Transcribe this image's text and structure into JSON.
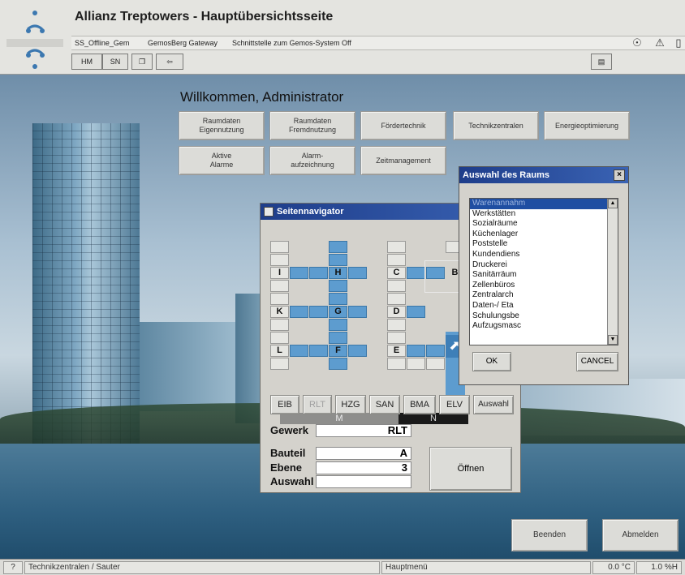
{
  "header": {
    "title": "Allianz Treptowers  - Hauptübersichtsseite",
    "info": {
      "user": "SS_Offline_Gem",
      "gateway": "GemosBerg Gateway",
      "interface": "Schnittstelle zum Gemos-System Off"
    },
    "toolbar": {
      "hm": "HM",
      "sn": "SN"
    },
    "icons": [
      "logo-icon",
      "copy-icon",
      "back-icon",
      "print-icon",
      "shield-icon",
      "warning-icon"
    ]
  },
  "main": {
    "welcome": "Willkommen, Administrator",
    "buttons": [
      "Raumdaten\nEigennutzung",
      "Raumdaten\nFremdnutzung",
      "Fördertechnik",
      "Technikzentralen",
      "Energieoptimierung",
      "Aktive\nAlarme",
      "Alarm-\naufzeichnung",
      "Zeitmanagement"
    ]
  },
  "navigator": {
    "title": "Seitennavigator",
    "labels": {
      "i": "I",
      "h": "H",
      "c": "C",
      "b": "B",
      "k": "K",
      "g": "G",
      "d": "D",
      "l": "L",
      "f": "F",
      "e": "E"
    },
    "sections": {
      "m": "M",
      "n": "N"
    },
    "gewerk_buttons": [
      "EIB",
      "RLT",
      "HZG",
      "SAN",
      "BMA",
      "ELV",
      "Auswahl"
    ],
    "form": {
      "gewerk_label": "Gewerk",
      "gewerk_value": "RLT",
      "bauteil_label": "Bauteil",
      "bauteil_value": "A",
      "ebene_label": "Ebene",
      "ebene_value": "3",
      "auswahl_label": "Auswahl",
      "auswahl_value": ""
    },
    "open_button": "Öffnen"
  },
  "room_dialog": {
    "title": "Auswahl des Raums",
    "close": "×",
    "items": [
      "Warenannahm",
      "Werkstätten",
      "Sozialräume",
      "Küchenlager",
      "Poststelle",
      "Kundendiens",
      "Druckerei",
      "Sanitärräum",
      "Zellenbüros",
      "Zentralarch",
      "Daten-/ Eta",
      "Schulungsbe",
      "Aufzugsmasc"
    ],
    "ok": "OK",
    "cancel": "CANCEL"
  },
  "bottom": {
    "exit": "Beenden",
    "logout": "Abmelden"
  },
  "status": {
    "location": "Technikzentralen / Sauter",
    "menu": "Hauptmenü",
    "temperature": "0.0 °C",
    "humidity": "1.0 %H"
  },
  "colors": {
    "title_bar": "#1e3d8a",
    "grid_blue": "#5d9ccf",
    "selection": "#1f4ea2"
  }
}
